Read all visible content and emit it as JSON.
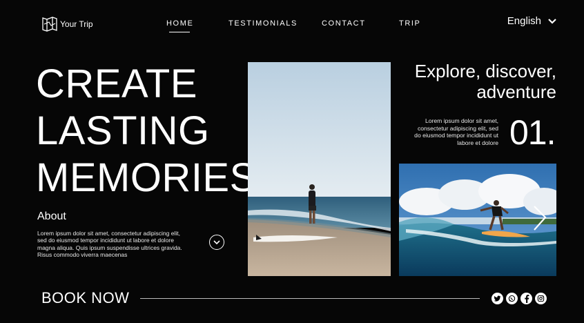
{
  "brand": {
    "name": "Your Trip",
    "logo_icon": "map-logo-icon"
  },
  "nav": {
    "items": [
      {
        "label": "HOME",
        "active": true
      },
      {
        "label": "TESTIMONIALS",
        "active": false
      },
      {
        "label": "CONTACT",
        "active": false
      },
      {
        "label": "TRIP",
        "active": false
      }
    ]
  },
  "language": {
    "selected": "English",
    "icon": "chevron-down-icon"
  },
  "hero": {
    "lines": [
      "CREATE",
      "LASTING",
      "MEMORIES"
    ]
  },
  "about": {
    "title": "About",
    "text": "Lorem ipsum dolor sit amet, consectetur adipiscing elit, sed do eiusmod tempor incididunt ut labore et dolore magna aliqua. Quis ipsum suspendisse ultrices gravida. Risus commodo viverra maecenas"
  },
  "feature": {
    "title_line1": "Explore, discover,",
    "title_line2": "adventure",
    "description": "Lorem ipsum dolor sit amet, consectetur adipiscing elit, sed do eiusmod tempor incididunt ut labore et dolore",
    "number": "01."
  },
  "cta": {
    "label": "BOOK NOW"
  },
  "social": [
    "twitter-icon",
    "whatsapp-icon",
    "facebook-icon",
    "instagram-icon"
  ],
  "colors": {
    "background": "#060606",
    "text": "#ffffff",
    "divider": "#bdbdbd"
  }
}
